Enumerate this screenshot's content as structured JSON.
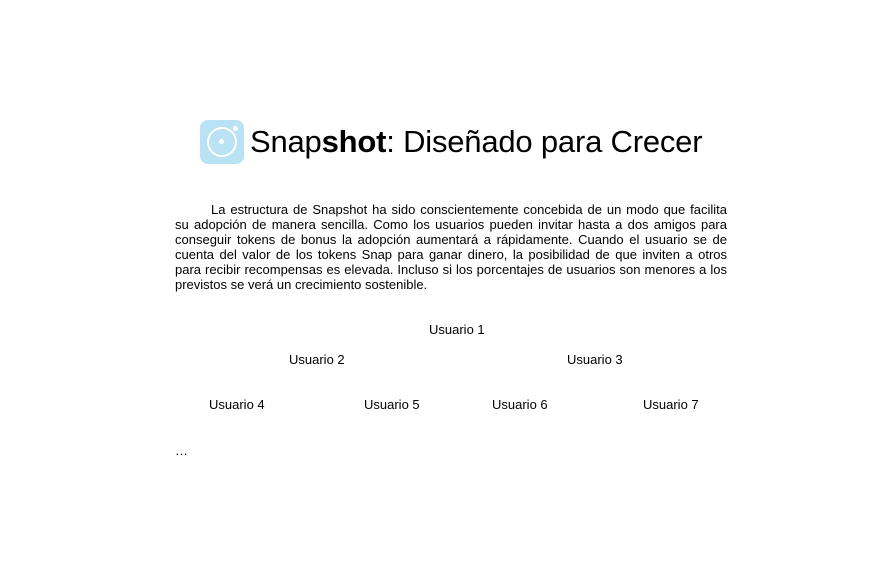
{
  "header": {
    "logo_icon": "camera-lens-icon",
    "logo_color": "#b9e2f4",
    "title_light": "Snap",
    "title_bold": "shot",
    "title_rest": ": Diseñado para Crecer"
  },
  "body": {
    "paragraph": "La estructura de Snapshot ha sido conscientemente concebida de un modo que facilita su adopción de manera sencilla. Como los usuarios pueden invitar hasta a dos amigos para conseguir tokens de bonus la adopción aumentará a rápidamente. Cuando el usuario se de cuenta del valor de los tokens Snap para ganar dinero, la posibilidad de que inviten a otros para recibir recompensas es elevada. Incluso si los porcentajes de usuarios son menores a los previstos se verá un crecimiento sostenible."
  },
  "tree": {
    "users": [
      "Usuario 1",
      "Usuario 2",
      "Usuario 3",
      "Usuario 4",
      "Usuario 5",
      "Usuario 6",
      "Usuario 7"
    ],
    "continuation": "…"
  }
}
